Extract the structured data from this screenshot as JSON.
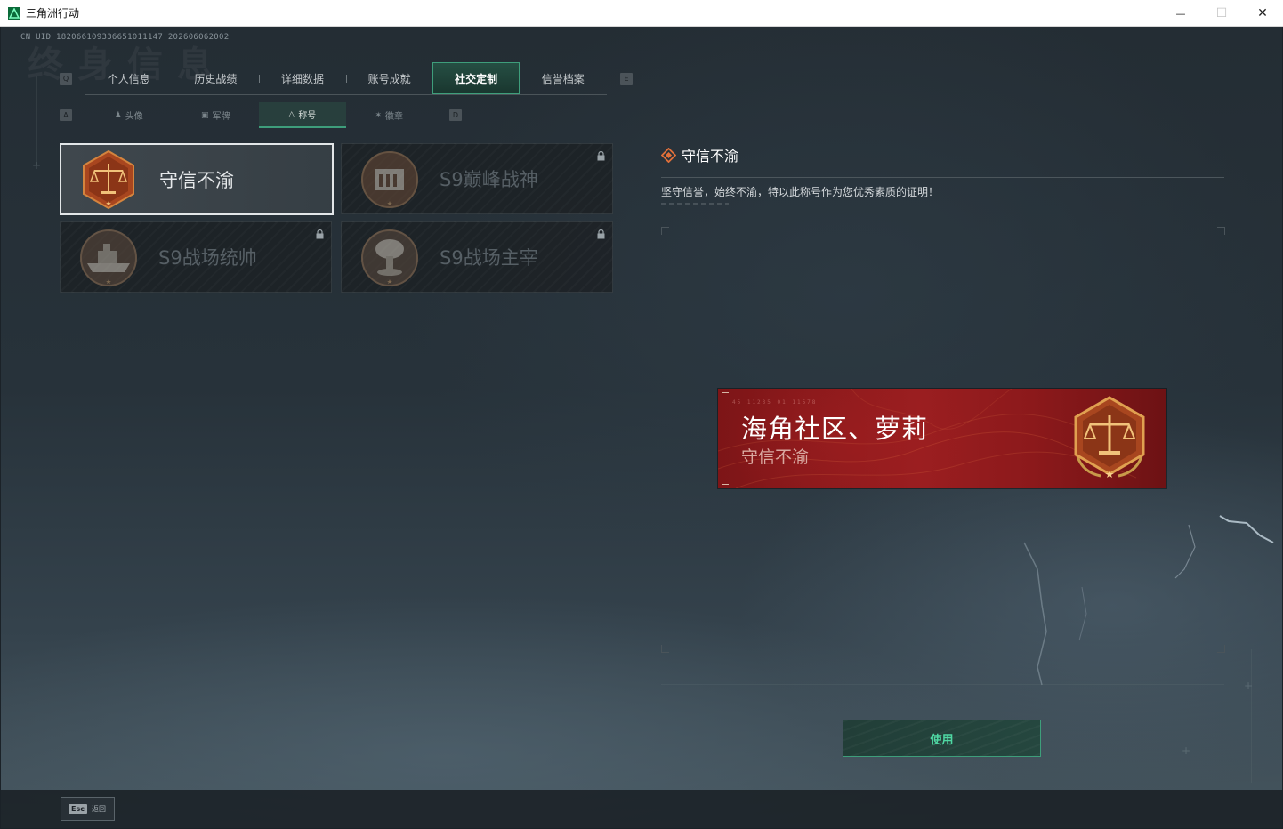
{
  "window": {
    "title": "三角洲行动",
    "minimize_label": "—",
    "maximize_label": "☐",
    "close_label": "✕"
  },
  "header": {
    "uid": "CN UID 182066109336651011147 202606062002",
    "watermark": "终身信息"
  },
  "top_tabs": {
    "left_key": "Q",
    "right_key": "E",
    "items": [
      {
        "label": "个人信息"
      },
      {
        "label": "历史战绩"
      },
      {
        "label": "详细数据"
      },
      {
        "label": "账号成就"
      },
      {
        "label": "社交定制",
        "active": true
      },
      {
        "label": "信誉档案"
      }
    ]
  },
  "sub_tabs": {
    "left_key": "A",
    "right_key": "D",
    "items": [
      {
        "label": "头像",
        "icon": "person-icon"
      },
      {
        "label": "军牌",
        "icon": "dogtag-icon"
      },
      {
        "label": "称号",
        "icon": "triangle-icon",
        "active": true
      },
      {
        "label": "徽章",
        "icon": "wings-icon"
      }
    ]
  },
  "title_cards": [
    {
      "name": "守信不渝",
      "icon": "scales-emblem",
      "selected": true,
      "locked": false
    },
    {
      "name": "S9巅峰战神",
      "icon": "fortress-emblem",
      "selected": false,
      "locked": true
    },
    {
      "name": "S9战场统帅",
      "icon": "warship-emblem",
      "selected": false,
      "locked": true
    },
    {
      "name": "S9战场主宰",
      "icon": "mushroom-cloud-emblem",
      "selected": false,
      "locked": true
    }
  ],
  "detail": {
    "title": "守信不渝",
    "title_icon": "diamond-icon",
    "description": "坚守信誉，始终不渝，特以此称号作为您优秀素质的证明！"
  },
  "banner": {
    "player_name": "海角社区、萝莉",
    "title": "守信不渝",
    "code_text": "45 11235   01 11578",
    "emblem": "scales-emblem"
  },
  "actions": {
    "use_label": "使用",
    "esc_key": "Esc",
    "back_label": "返回"
  },
  "colors": {
    "accent": "#3e9e7b",
    "use_text": "#4fd7a3",
    "banner_red": "#9a1e20",
    "emblem_orange": "#a8461f"
  }
}
